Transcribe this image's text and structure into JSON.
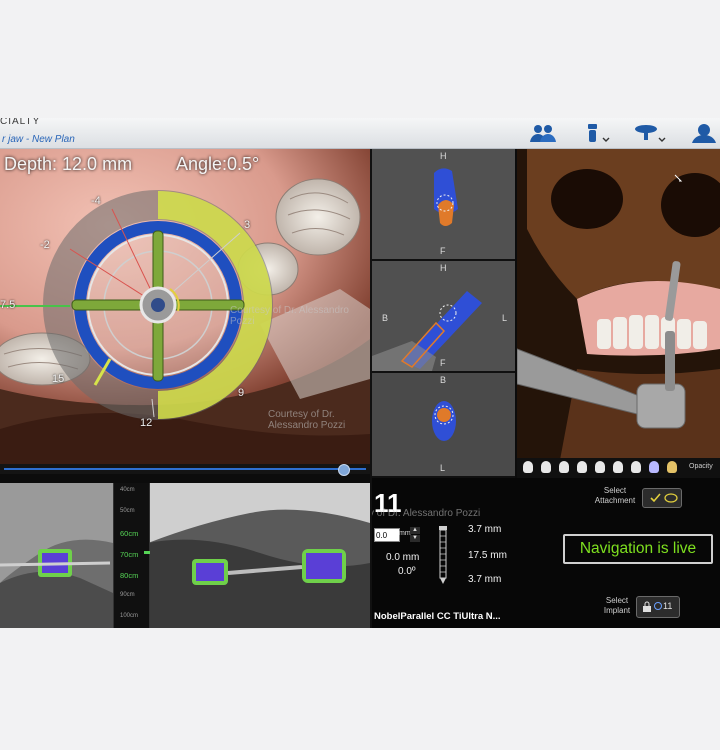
{
  "window": {
    "app_title": "CIALTY",
    "plan_label": "r jaw - New Plan"
  },
  "toolbar": {
    "icons": [
      "users-icon",
      "implant-dropdown-icon",
      "jaw-dropdown-icon",
      "patient-icon"
    ]
  },
  "view3d": {
    "depth": "Depth: 12.0 mm",
    "angle": "Angle:0.5°",
    "ring_labels": [
      "-4",
      "-2",
      "3",
      "7.5",
      "9",
      "12",
      "15"
    ],
    "watermark": "Courtesy of Dr. Alessandro Pozzi"
  },
  "slices": [
    {
      "top": "H",
      "bottom": "F",
      "left": "",
      "right": ""
    },
    {
      "top": "H",
      "bottom": "F",
      "left": "B",
      "right": "L"
    },
    {
      "top": "B",
      "bottom": "L",
      "left": "",
      "right": ""
    }
  ],
  "skull_view": {
    "opacity_label": "Opacity"
  },
  "tracking": {
    "scale_labels": [
      "40cm",
      "50cm",
      "60cm",
      "70cm",
      "80cm",
      "90cm",
      "100cm"
    ],
    "highlight_labels": [
      "60cm",
      "70cm",
      "80cm"
    ]
  },
  "info": {
    "tooth_number": "11",
    "offset_value": "0.0",
    "offset_unit": "mm",
    "depth_offset": "0.0 mm",
    "angle_offset": "0.0º",
    "top_length": "3.7 mm",
    "implant_length": "17.5 mm",
    "bottom_length": "3.7 mm",
    "implant_name": "NobelParallel CC TiUltra N...",
    "select_attachment": "Select Attachment",
    "select_implant": "Select Implant",
    "implant_badge": "11",
    "nav_status": "Navigation is live"
  },
  "colors": {
    "accent_blue": "#2e6fd0",
    "live_green": "#7ee01f",
    "ring_yellow": "#d6e34a",
    "handle_green": "#7ea83a"
  }
}
